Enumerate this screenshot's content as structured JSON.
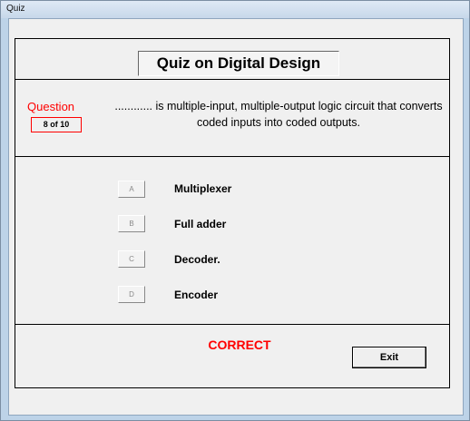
{
  "window": {
    "title": "Quiz"
  },
  "header": {
    "quiz_title": "Quiz on Digital Design"
  },
  "question": {
    "label": "Question",
    "counter": "8  of 10",
    "text": "............ is multiple-input, multiple-output logic circuit that converts coded inputs into coded outputs."
  },
  "options": [
    {
      "key": "A",
      "label": "Multiplexer"
    },
    {
      "key": "B",
      "label": "Full adder"
    },
    {
      "key": "C",
      "label": "Decoder."
    },
    {
      "key": "D",
      "label": "Encoder"
    }
  ],
  "status": {
    "text": "CORRECT",
    "color": "#ff0000"
  },
  "actions": {
    "exit_label": "Exit"
  }
}
